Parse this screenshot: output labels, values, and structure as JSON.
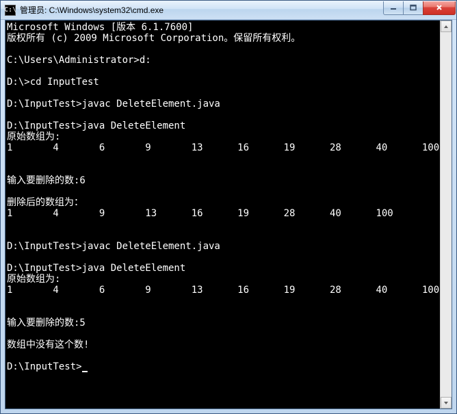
{
  "window": {
    "icon_label": "C:\\",
    "title": "管理员: C:\\Windows\\system32\\cmd.exe"
  },
  "terminal": {
    "lines": [
      "Microsoft Windows [版本 6.1.7600]",
      "版权所有 (c) 2009 Microsoft Corporation。保留所有权利。",
      "",
      "C:\\Users\\Administrator>d:",
      "",
      "D:\\>cd InputTest",
      "",
      "D:\\InputTest>javac DeleteElement.java",
      "",
      "D:\\InputTest>java DeleteElement",
      "原始数组为:",
      "1       4       6       9       13      16      19      28      40      100",
      "",
      "",
      "输入要删除的数:6",
      "",
      "删除后的数组为：",
      "1       4       9       13      16      19      28      40      100",
      "",
      "",
      "D:\\InputTest>javac DeleteElement.java",
      "",
      "D:\\InputTest>java DeleteElement",
      "原始数组为:",
      "1       4       6       9       13      16      19      28      40      100",
      "",
      "",
      "输入要删除的数:5",
      "",
      "数组中没有这个数!",
      "",
      "D:\\InputTest>"
    ]
  }
}
